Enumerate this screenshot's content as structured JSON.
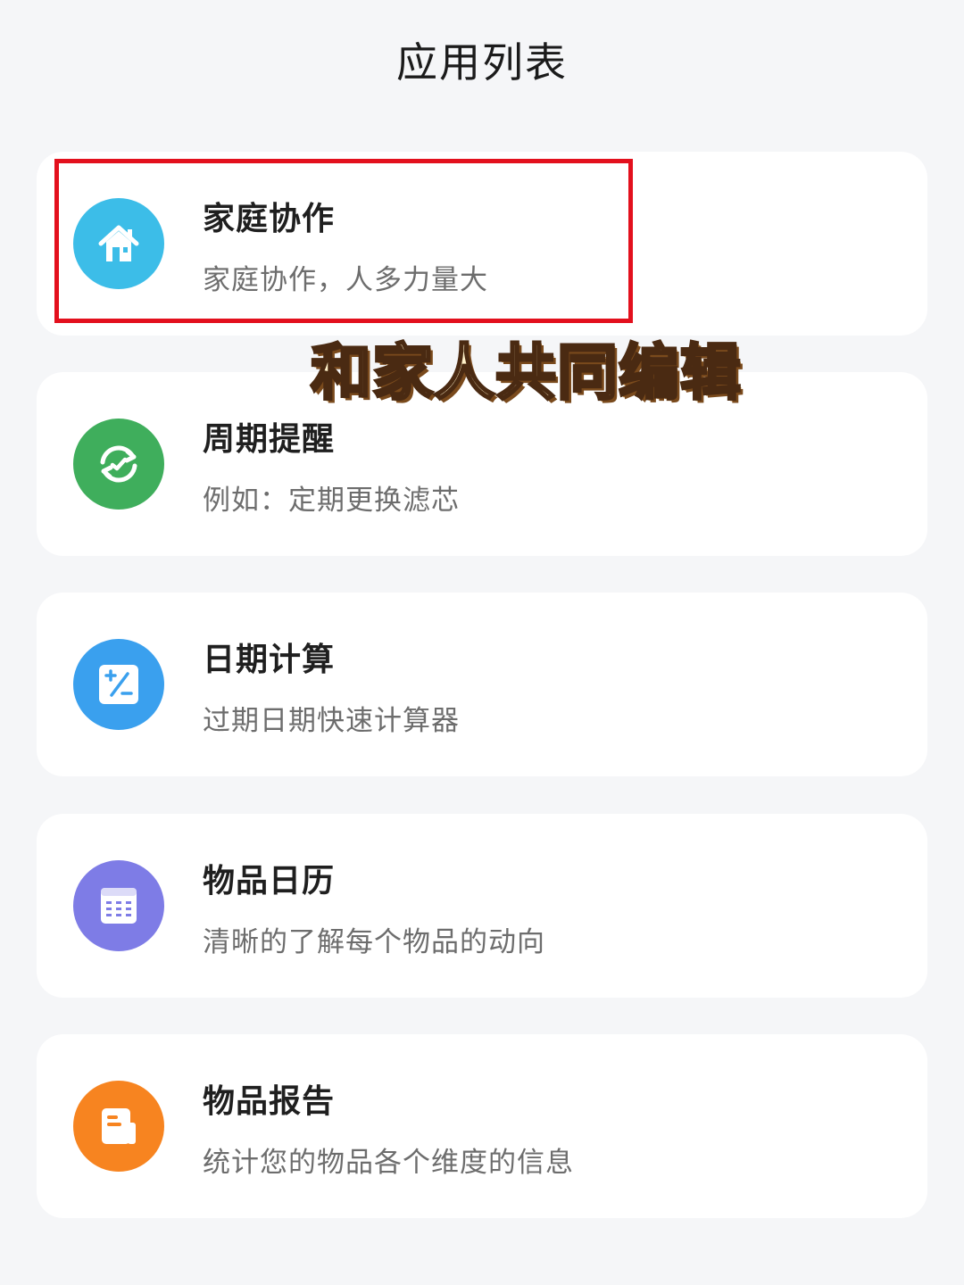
{
  "header": {
    "title": "应用列表"
  },
  "apps": [
    {
      "title": "家庭协作",
      "subtitle": "家庭协作，人多力量大",
      "icon": "home-icon",
      "color": "#3cbde8"
    },
    {
      "title": "周期提醒",
      "subtitle": "例如：定期更换滤芯",
      "icon": "cycle-icon",
      "color": "#3fae5c"
    },
    {
      "title": "日期计算",
      "subtitle": "过期日期快速计算器",
      "icon": "calculator-icon",
      "color": "#3aa0ee"
    },
    {
      "title": "物品日历",
      "subtitle": "清晰的了解每个物品的动向",
      "icon": "calendar-icon",
      "color": "#7e7ce6"
    },
    {
      "title": "物品报告",
      "subtitle": "统计您的物品各个维度的信息",
      "icon": "report-icon",
      "color": "#f78420"
    }
  ],
  "overlay": {
    "caption": "和家人共同编辑",
    "highlight_color": "#e3101d"
  }
}
